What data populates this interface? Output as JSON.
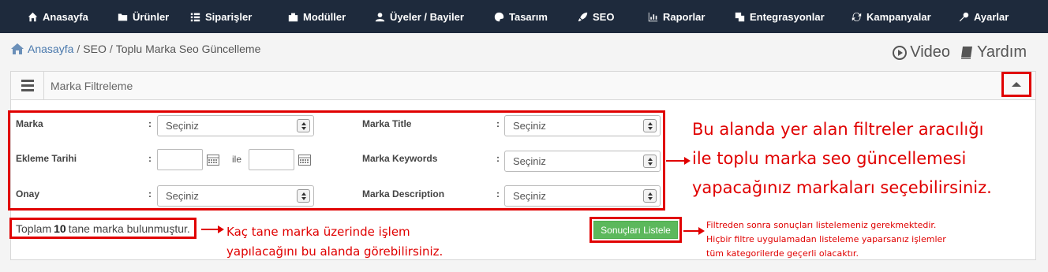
{
  "nav": {
    "items": [
      {
        "label": "Anasayfa",
        "icon": "home-icon"
      },
      {
        "label": "Ürünler",
        "icon": "folder-icon"
      },
      {
        "label": "Siparişler",
        "icon": "list-icon"
      },
      {
        "label": "Modüller",
        "icon": "modules-icon"
      },
      {
        "label": "Üyeler / Bayiler",
        "icon": "users-icon"
      },
      {
        "label": "Tasarım",
        "icon": "palette-icon"
      },
      {
        "label": "SEO",
        "icon": "rocket-icon"
      },
      {
        "label": "Raporlar",
        "icon": "chart-icon"
      },
      {
        "label": "Entegrasyonlar",
        "icon": "integration-icon"
      },
      {
        "label": "Kampanyalar",
        "icon": "campaign-icon"
      },
      {
        "label": "Ayarlar",
        "icon": "wrench-icon"
      }
    ]
  },
  "breadcrumb": {
    "home": "Anasayfa",
    "sep1": "/",
    "seo": "SEO",
    "sep2": "/",
    "current": "Toplu Marka Seo Güncelleme"
  },
  "helpers": {
    "video": "Video",
    "help": "Yardım"
  },
  "panel": {
    "title": "Marka Filtreleme"
  },
  "filters": {
    "colon": ":",
    "marka": {
      "label": "Marka",
      "value": "Seçiniz"
    },
    "ekleme_tarihi": {
      "label": "Ekleme Tarihi",
      "between": "ile"
    },
    "onay": {
      "label": "Onay",
      "value": "Seçiniz"
    },
    "marka_title": {
      "label": "Marka Title",
      "value": "Seçiniz"
    },
    "marka_keywords": {
      "label": "Marka Keywords",
      "value": "Seçiniz"
    },
    "marka_description": {
      "label": "Marka Description",
      "value": "Seçiniz"
    }
  },
  "total": {
    "prefix": "Toplam",
    "count": "10",
    "suffix": "tane marka bulunmuştur."
  },
  "list_button": "Sonuçları Listele",
  "annotations": {
    "filters_note": [
      "Bu alanda yer alan filtreler aracılığı",
      "ile toplu marka seo güncellemesi",
      "yapacağınız markaları seçebilirsiniz."
    ],
    "count_note": [
      "Kaç tane marka üzerinde işlem",
      "yapılacağını bu alanda görebilirsiniz."
    ],
    "list_note": [
      "Filtreden sonra sonuçları listelemeniz gerekmektedir.",
      "Hiçbir filtre uygulamadan listeleme yaparsanız işlemler",
      "tüm kategorilerde geçerli olacaktır."
    ]
  },
  "colors": {
    "nav_bg": "#1e2a3c",
    "highlight": "#e00000",
    "button": "#5cb85c"
  }
}
